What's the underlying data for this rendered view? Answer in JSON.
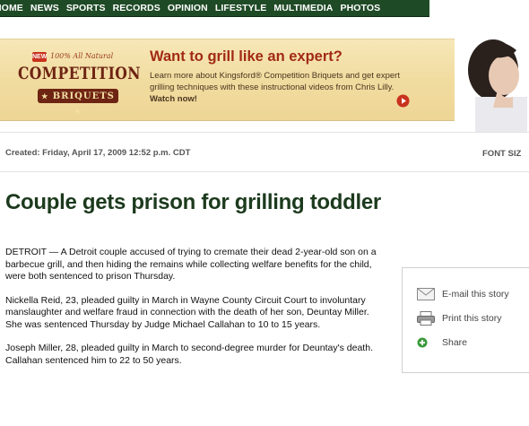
{
  "nav": {
    "items": [
      "HOME",
      "NEWS",
      "SPORTS",
      "RECORDS",
      "OPINION",
      "LIFESTYLE",
      "MULTIMEDIA",
      "PHOTOS"
    ]
  },
  "ad": {
    "logo_new": "NEW",
    "logo_tagline": "100% All Natural",
    "logo_main": "COMPETITION",
    "logo_sub": "BRIQUETS",
    "title": "Want to grill like an expert?",
    "body": "Learn more about Kingsford® Competition Briquets and get expert grilling techniques with these instructional videos from Chris Lilly.",
    "watch": "Watch now!",
    "colors": {
      "title": "#a12a14",
      "brand": "#6e2413",
      "bg": "#f1dca0"
    }
  },
  "meta": {
    "created": "Created: Friday, April 17, 2009 12:52 p.m. CDT",
    "font_size": "FONT SIZ"
  },
  "article": {
    "headline": "Couple gets prison for grilling toddler",
    "paragraphs": [
      "DETROIT — A Detroit couple accused of trying to cremate their dead 2-year-old son on a barbecue grill, and then hiding the remains while collecting welfare benefits for the child, were both sentenced to prison Thursday.",
      "Nickella Reid, 23, pleaded guilty in March in Wayne County Circuit Court to involuntary manslaughter and welfare fraud in connection with the death of her son, Deuntay Miller. She was sentenced Thursday by Judge Michael Callahan to 10 to 15 years.",
      "Joseph Miller, 28, pleaded guilty in March to second-degree murder for Deuntay's death. Callahan sentenced him to 22 to 50 years."
    ]
  },
  "tools": {
    "email": "E-mail this story",
    "print": "Print this story",
    "share": "Share",
    "icons": [
      "envelope-icon",
      "printer-icon",
      "plus-icon"
    ]
  },
  "colors": {
    "nav_bg": "#1f4a26",
    "headline": "#1c3a1d",
    "share_plus": "#3a9a3a"
  }
}
